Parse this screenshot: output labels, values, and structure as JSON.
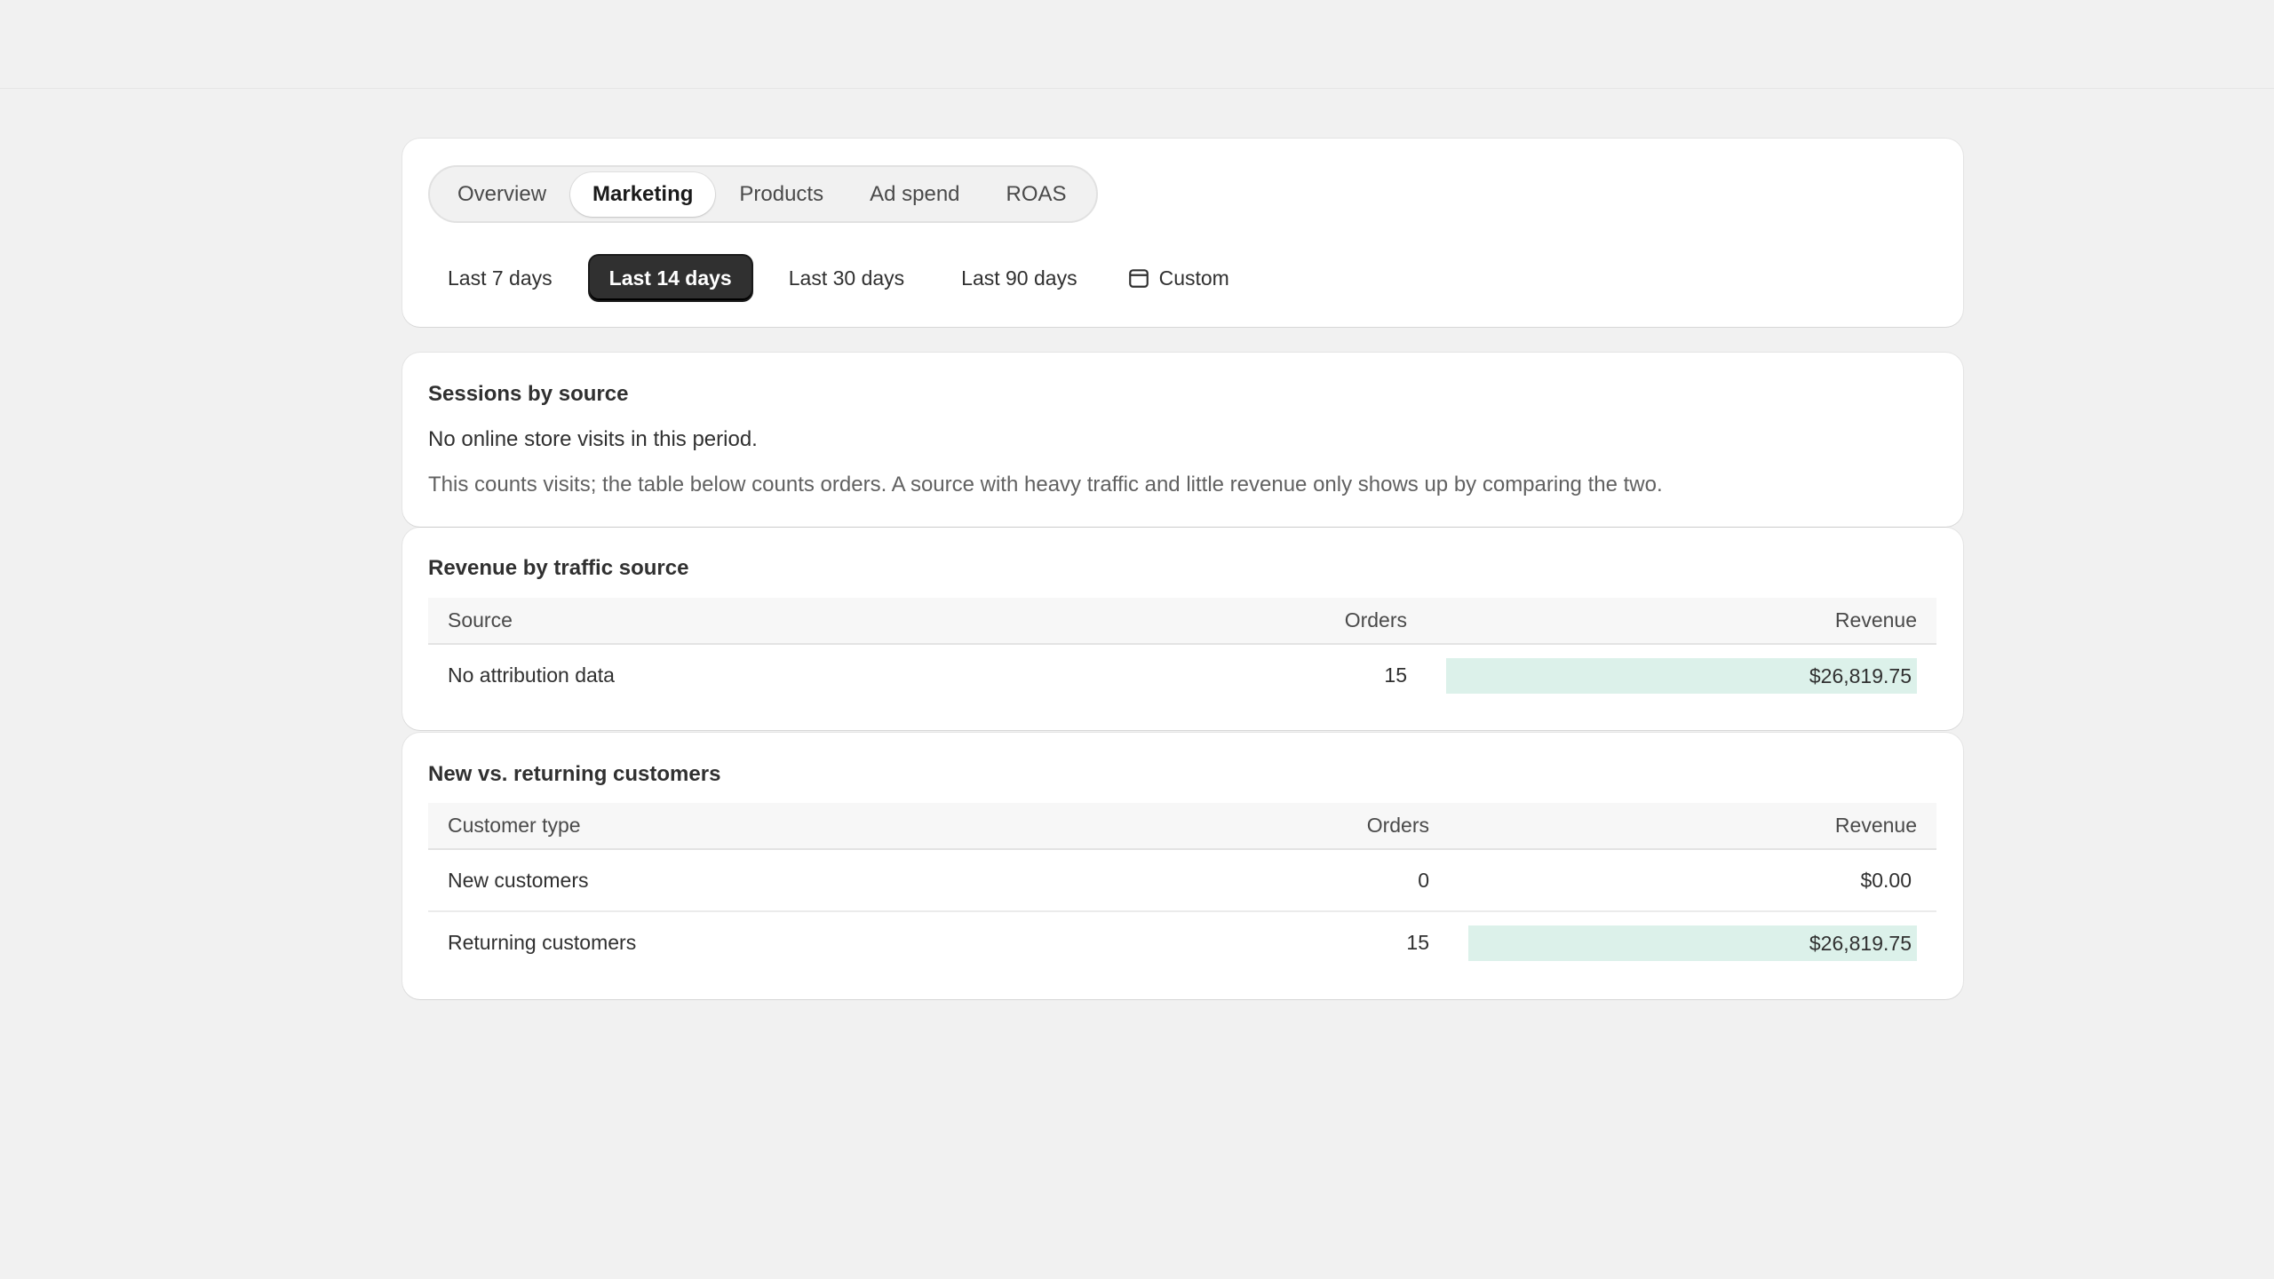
{
  "tabs": [
    {
      "label": "Overview",
      "active": false
    },
    {
      "label": "Marketing",
      "active": true
    },
    {
      "label": "Products",
      "active": false
    },
    {
      "label": "Ad spend",
      "active": false
    },
    {
      "label": "ROAS",
      "active": false
    }
  ],
  "ranges": [
    {
      "label": "Last 7 days",
      "active": false
    },
    {
      "label": "Last 14 days",
      "active": true
    },
    {
      "label": "Last 30 days",
      "active": false
    },
    {
      "label": "Last 90 days",
      "active": false
    },
    {
      "label": "Custom",
      "active": false,
      "icon": "calendar-icon"
    }
  ],
  "sessions": {
    "title": "Sessions by source",
    "empty_message": "No online store visits in this period.",
    "note": "This counts visits; the table below counts orders. A source with heavy traffic and little revenue only shows up by comparing the two."
  },
  "revenue_by_source": {
    "title": "Revenue by traffic source",
    "headers": {
      "source": "Source",
      "orders": "Orders",
      "revenue": "Revenue"
    },
    "rows": [
      {
        "source": "No attribution data",
        "orders": "15",
        "revenue": "$26,819.75",
        "share": 1.0
      }
    ]
  },
  "customers": {
    "title": "New vs. returning customers",
    "headers": {
      "type": "Customer type",
      "orders": "Orders",
      "revenue": "Revenue"
    },
    "rows": [
      {
        "type": "New customers",
        "orders": "0",
        "revenue": "$0.00",
        "share": 0
      },
      {
        "type": "Returning customers",
        "orders": "15",
        "revenue": "$26,819.75",
        "share": 1.0
      }
    ]
  },
  "colors": {
    "page_bg": "#f1f1f1",
    "card_bg": "#ffffff",
    "active_range_bg": "#303030",
    "revenue_bar": "#dcf1ea"
  }
}
